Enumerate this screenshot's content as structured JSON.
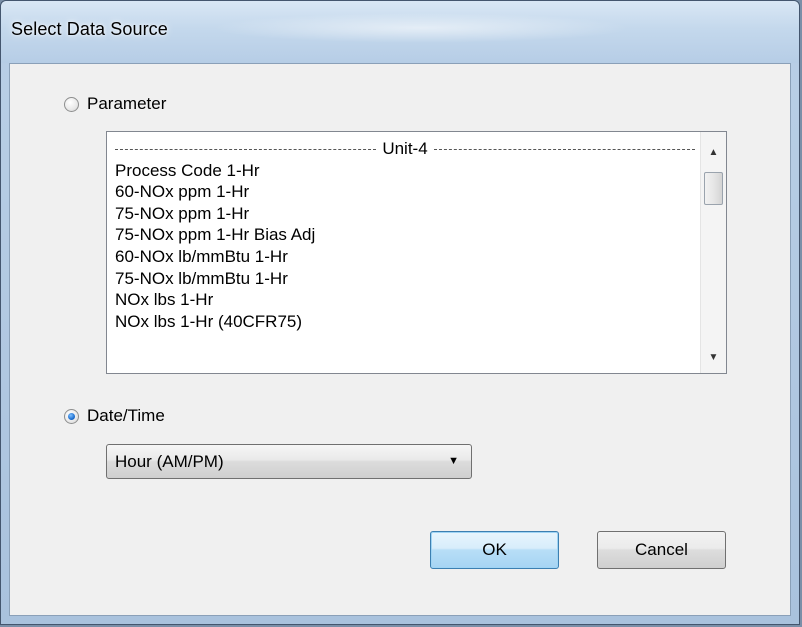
{
  "window": {
    "title": "Select Data Source"
  },
  "parameter_option": {
    "label": "Parameter",
    "selected": false
  },
  "parameter_list": {
    "header": "Unit-4",
    "items": [
      "Process Code 1-Hr",
      "60-NOx ppm 1-Hr",
      "75-NOx ppm 1-Hr",
      "75-NOx ppm 1-Hr Bias Adj",
      "60-NOx lb/mmBtu 1-Hr",
      "75-NOx lb/mmBtu 1-Hr",
      "NOx lbs 1-Hr",
      "NOx lbs 1-Hr (40CFR75)"
    ]
  },
  "datetime_option": {
    "label": "Date/Time",
    "selected": true
  },
  "datetime_combo": {
    "value": "Hour (AM/PM)"
  },
  "buttons": {
    "ok_label": "OK",
    "cancel_label": "Cancel"
  },
  "icons": {
    "scroll_up": "scroll-up-arrow-icon",
    "scroll_down": "scroll-down-arrow-icon",
    "dropdown": "chevron-down-icon"
  },
  "colors": {
    "title_bar": "#c4d8ec",
    "client_background": "#f0f0f0",
    "default_button_border": "#3c7fb1"
  }
}
